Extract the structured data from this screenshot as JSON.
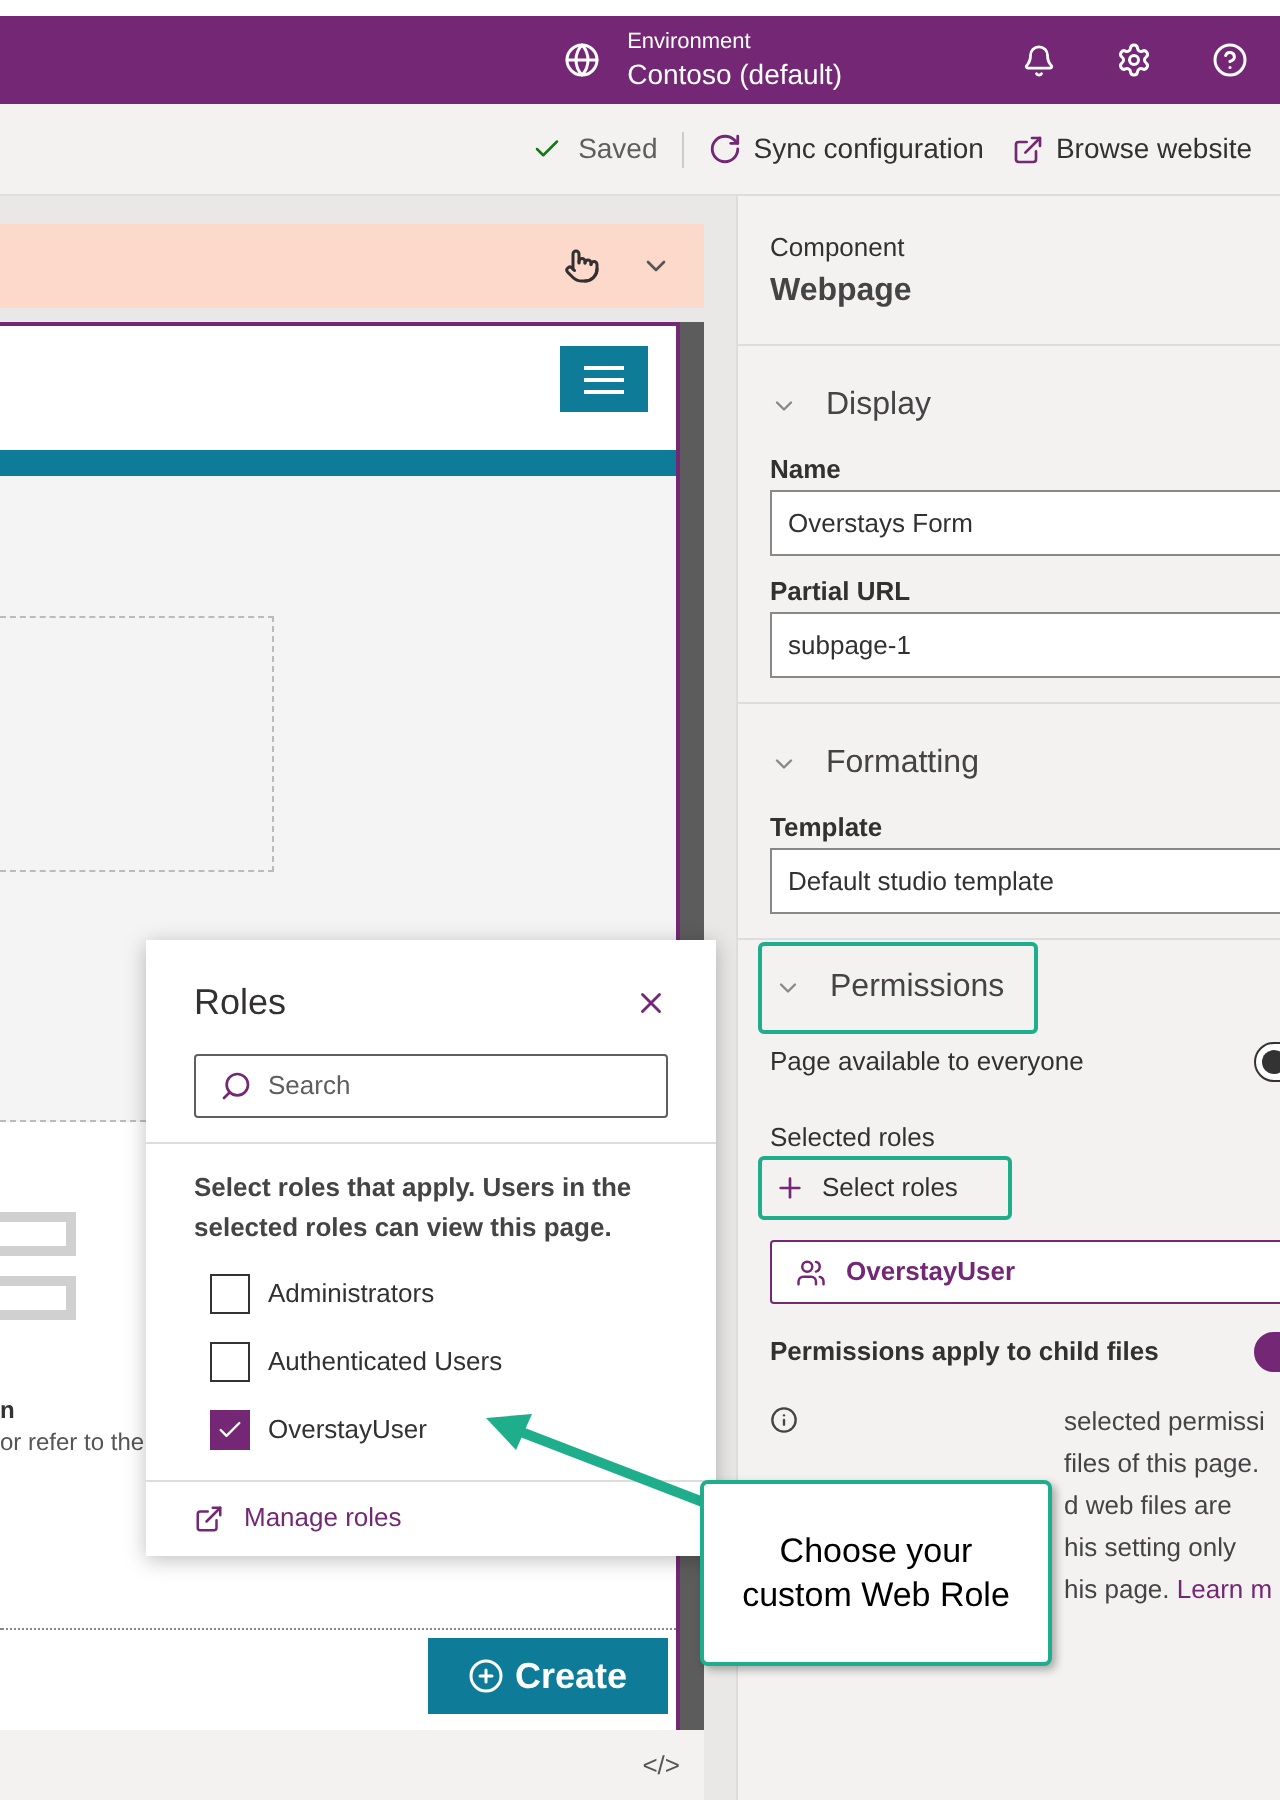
{
  "header": {
    "environment_label": "Environment",
    "environment_name": "Contoso (default)"
  },
  "toolbar": {
    "status": "Saved",
    "actions": [
      {
        "kind": "sync",
        "label": "Sync configuration"
      },
      {
        "kind": "browse",
        "label": "Browse website"
      }
    ]
  },
  "preview": {
    "fragments": [
      "n",
      "or refer to the"
    ],
    "create_button": "Create",
    "code_toggle": "</>"
  },
  "roles_dialog": {
    "title": "Roles",
    "search": {
      "placeholder": "Search"
    },
    "description": "Select roles that apply. Users in the selected roles can view this page.",
    "roles": [
      {
        "label": "Administrators",
        "checked": false
      },
      {
        "label": "Authenticated Users",
        "checked": false
      },
      {
        "label": "OverstayUser",
        "checked": true
      }
    ],
    "manage_link": "Manage roles"
  },
  "callout": {
    "text": "Choose your custom Web Role"
  },
  "panel": {
    "component_label": "Component",
    "component_name": "Webpage",
    "sections": [
      {
        "title": "Display",
        "expanded": true,
        "fields": [
          {
            "label": "Name",
            "value": "Overstays Form"
          },
          {
            "label": "Partial URL",
            "value": "subpage-1"
          }
        ]
      },
      {
        "title": "Formatting",
        "expanded": true,
        "fields": [
          {
            "label": "Template",
            "value": "Default studio template"
          }
        ]
      }
    ],
    "permissions": {
      "title": "Permissions",
      "everyone": {
        "label": "Page available to everyone",
        "on": false
      },
      "selected_roles_label": "Selected roles",
      "select_button": "Select roles",
      "chips": [
        "OverstayUser"
      ],
      "child": {
        "label": "Permissions apply to child files",
        "on": true
      },
      "info_lines": [
        "selected permissi",
        "files of this page.",
        "d web files are",
        "his setting only",
        "his page."
      ],
      "learn_link": "Learn m"
    }
  }
}
